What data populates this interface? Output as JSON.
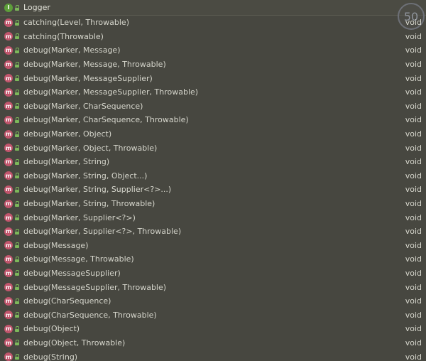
{
  "header": {
    "icon": "interface-icon",
    "badge_letter": "I",
    "title": "Logger"
  },
  "zoom_indicator": "50",
  "method_badge_letter": "m",
  "colors": {
    "background": "#474740",
    "method_badge": "#c1556c",
    "interface_badge": "#5d9e3a",
    "text": "#d6d6cc"
  },
  "items": [
    {
      "signature": "catching(Level, Throwable)",
      "return_type": "void"
    },
    {
      "signature": "catching(Throwable)",
      "return_type": "void"
    },
    {
      "signature": "debug(Marker, Message)",
      "return_type": "void"
    },
    {
      "signature": "debug(Marker, Message, Throwable)",
      "return_type": "void"
    },
    {
      "signature": "debug(Marker, MessageSupplier)",
      "return_type": "void"
    },
    {
      "signature": "debug(Marker, MessageSupplier, Throwable)",
      "return_type": "void"
    },
    {
      "signature": "debug(Marker, CharSequence)",
      "return_type": "void"
    },
    {
      "signature": "debug(Marker, CharSequence, Throwable)",
      "return_type": "void"
    },
    {
      "signature": "debug(Marker, Object)",
      "return_type": "void"
    },
    {
      "signature": "debug(Marker, Object, Throwable)",
      "return_type": "void"
    },
    {
      "signature": "debug(Marker, String)",
      "return_type": "void"
    },
    {
      "signature": "debug(Marker, String, Object...)",
      "return_type": "void"
    },
    {
      "signature": "debug(Marker, String, Supplier<?>...)",
      "return_type": "void"
    },
    {
      "signature": "debug(Marker, String, Throwable)",
      "return_type": "void"
    },
    {
      "signature": "debug(Marker, Supplier<?>)",
      "return_type": "void"
    },
    {
      "signature": "debug(Marker, Supplier<?>, Throwable)",
      "return_type": "void"
    },
    {
      "signature": "debug(Message)",
      "return_type": "void"
    },
    {
      "signature": "debug(Message, Throwable)",
      "return_type": "void"
    },
    {
      "signature": "debug(MessageSupplier)",
      "return_type": "void"
    },
    {
      "signature": "debug(MessageSupplier, Throwable)",
      "return_type": "void"
    },
    {
      "signature": "debug(CharSequence)",
      "return_type": "void"
    },
    {
      "signature": "debug(CharSequence, Throwable)",
      "return_type": "void"
    },
    {
      "signature": "debug(Object)",
      "return_type": "void"
    },
    {
      "signature": "debug(Object, Throwable)",
      "return_type": "void"
    },
    {
      "signature": "debug(String)",
      "return_type": "void"
    }
  ]
}
